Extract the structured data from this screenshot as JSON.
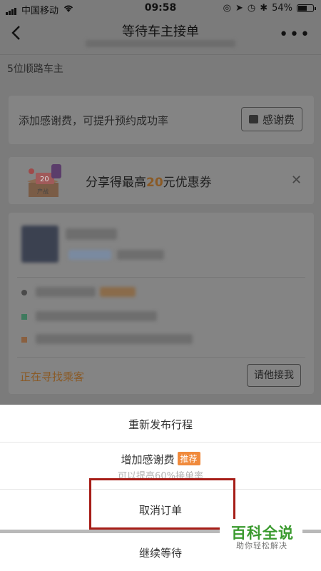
{
  "status_bar": {
    "carrier": "中国移动",
    "time": "09:58",
    "battery": "54%"
  },
  "nav": {
    "back_icon": "chevron-left-icon",
    "title": "等待车主接单",
    "more_icon": "more-dots-icon"
  },
  "owners_count": "5位顺路车主",
  "thanks_card": {
    "text": "添加感谢费，可提升预约成功率",
    "button_label": "感谢费"
  },
  "share_card": {
    "text_before": "分享得最高",
    "amount": "20",
    "text_after": "元优惠券",
    "close_icon": "close-icon"
  },
  "order_card": {
    "status_text": "正在寻找乘客",
    "ask_button": "请他接我"
  },
  "action_sheet": {
    "repost": "重新发布行程",
    "add_thanks": "增加感谢费",
    "add_thanks_tag": "推荐",
    "add_thanks_sub": "可以提高60%接单率",
    "cancel": "取消订单",
    "keep_waiting": "继续等待"
  },
  "watermark": {
    "title": "百科全说",
    "subtitle": "助你轻松解决"
  },
  "colors": {
    "accent_orange": "#f08a3c",
    "highlight_box": "#a61d17",
    "watermark_green": "#3a9a2e"
  }
}
